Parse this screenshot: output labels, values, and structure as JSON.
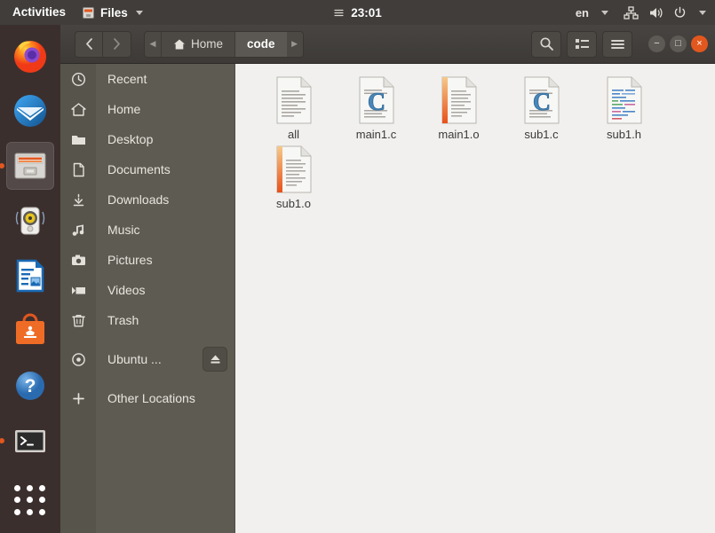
{
  "topbar": {
    "activities": "Activities",
    "app_icon": "files-cabinet-icon",
    "app_name": "Files",
    "clock": "23:01",
    "notification_icon": "notification-list-icon",
    "language": "en",
    "tray_icons": [
      "network-icon",
      "volume-icon",
      "power-icon",
      "menu-caret-icon"
    ]
  },
  "dock": {
    "items": [
      {
        "name": "firefox",
        "running": false,
        "active": false
      },
      {
        "name": "thunderbird",
        "running": false,
        "active": false
      },
      {
        "name": "files",
        "running": true,
        "active": true
      },
      {
        "name": "rhythmbox",
        "running": false,
        "active": false
      },
      {
        "name": "libreoffice-writer",
        "running": false,
        "active": false
      },
      {
        "name": "ubuntu-software",
        "running": false,
        "active": false
      },
      {
        "name": "help",
        "running": false,
        "active": false
      },
      {
        "name": "terminal",
        "running": true,
        "active": false
      }
    ],
    "app_grid": "show-applications-icon"
  },
  "headerbar": {
    "back": "back-icon",
    "forward": "forward-icon",
    "path_prev": "path-scroll-left-icon",
    "path_next": "path-scroll-right-icon",
    "breadcrumbs": [
      {
        "label": "Home",
        "icon": "home-icon",
        "current": false
      },
      {
        "label": "code",
        "icon": "",
        "current": true
      }
    ],
    "search": "search-icon",
    "view_toggle": "list-view-icon",
    "menu": "hamburger-menu-icon",
    "window_controls": {
      "minimize": "−",
      "maximize": "□",
      "close": "×"
    }
  },
  "sidebar": {
    "items": [
      {
        "label": "Recent",
        "icon": "clock-icon",
        "eject": false
      },
      {
        "label": "Home",
        "icon": "home-icon",
        "eject": false
      },
      {
        "label": "Desktop",
        "icon": "folder-icon",
        "eject": false
      },
      {
        "label": "Documents",
        "icon": "document-icon",
        "eject": false
      },
      {
        "label": "Downloads",
        "icon": "download-icon",
        "eject": false
      },
      {
        "label": "Music",
        "icon": "music-icon",
        "eject": false
      },
      {
        "label": "Pictures",
        "icon": "camera-icon",
        "eject": false
      },
      {
        "label": "Videos",
        "icon": "video-icon",
        "eject": false
      },
      {
        "label": "Trash",
        "icon": "trash-icon",
        "eject": false
      },
      {
        "label": "Ubuntu ...",
        "icon": "disc-icon",
        "eject": true
      },
      {
        "label": "Other Locations",
        "icon": "plus-icon",
        "eject": false
      }
    ]
  },
  "files": [
    {
      "name": "all",
      "type": "text"
    },
    {
      "name": "main1.c",
      "type": "c-source"
    },
    {
      "name": "main1.o",
      "type": "object"
    },
    {
      "name": "sub1.c",
      "type": "c-source"
    },
    {
      "name": "sub1.h",
      "type": "c-header"
    },
    {
      "name": "sub1.o",
      "type": "object"
    }
  ],
  "colors": {
    "topbar": "#403d3a",
    "dock": "#3b2f2e",
    "sidebar": "#5e5c52",
    "headerbar": "#3d3a37",
    "content": "#f1f0ee",
    "accent": "#e2571e"
  }
}
